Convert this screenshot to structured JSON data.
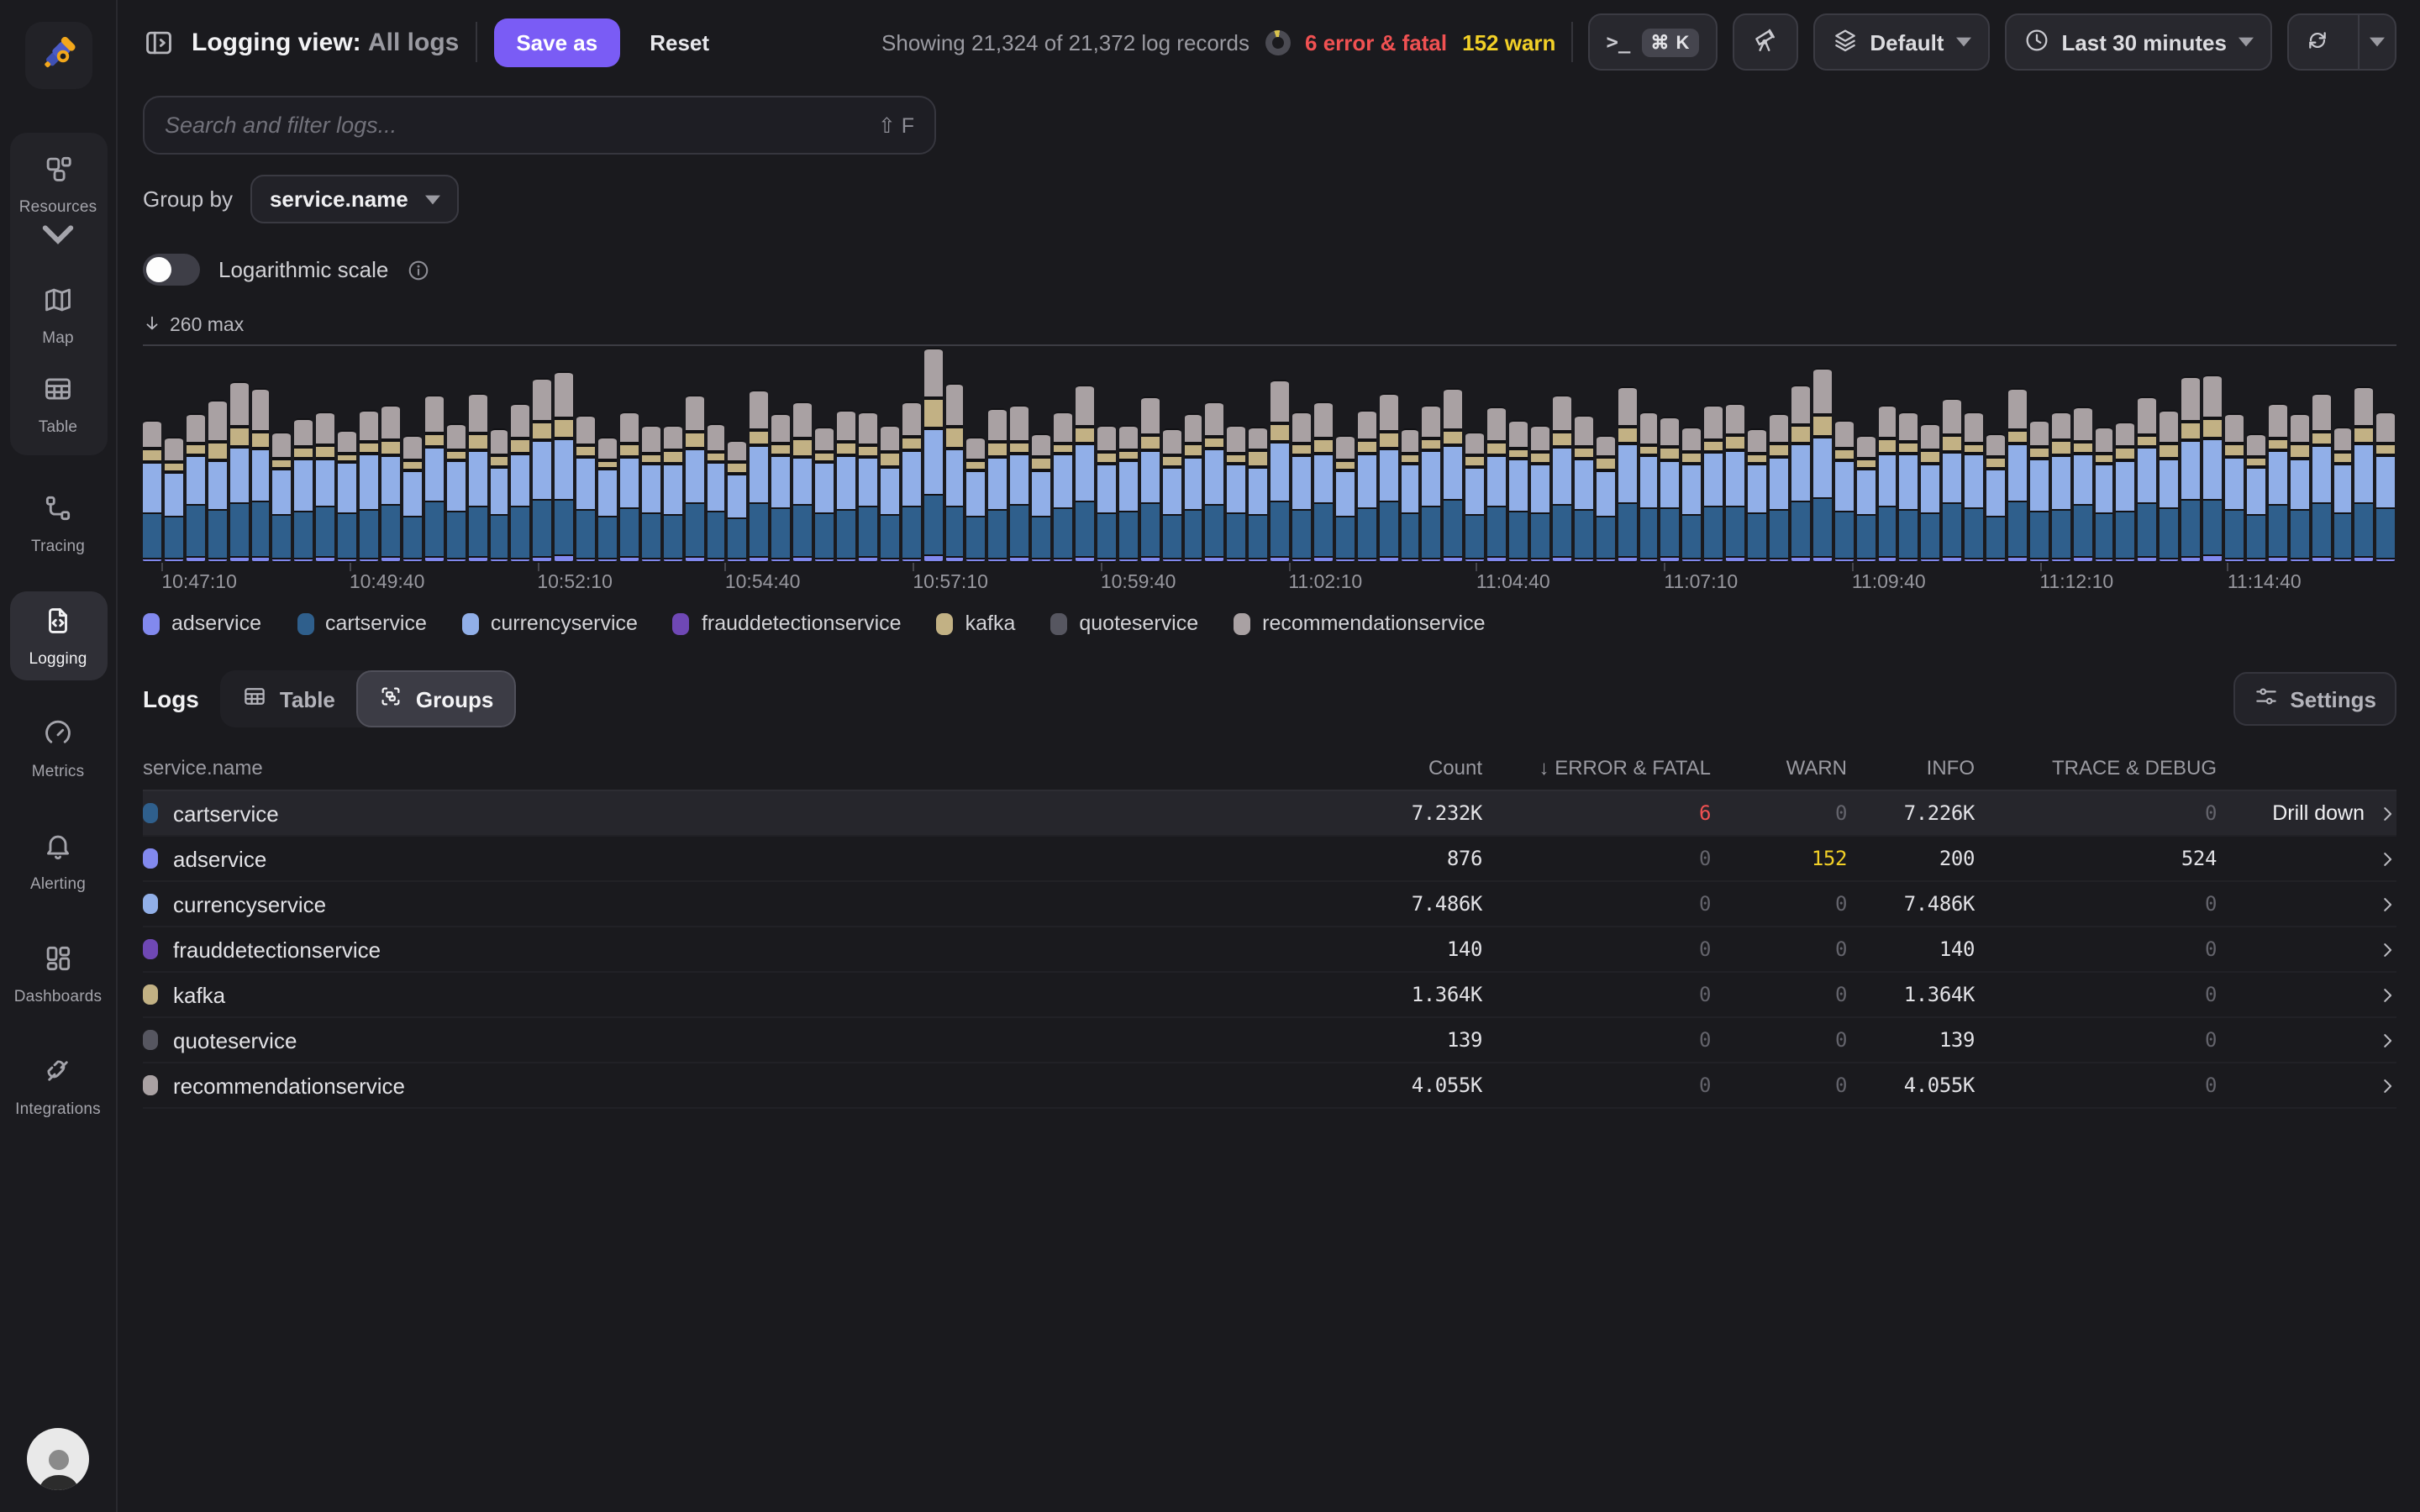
{
  "topbar": {
    "title": "Logging view:",
    "title_suffix": "All logs",
    "save_as": "Save as",
    "reset": "Reset",
    "showing": "Showing 21,324 of 21,372 log records",
    "error_badge": "6 error & fatal",
    "warn_badge": "152 warn",
    "command_shortcut": "⌘ K",
    "terminal_glyph": ">_",
    "default_label": "Default",
    "time_range": "Last 30 minutes",
    "colors": {
      "accent": "#7a5cf5",
      "error": "#f05152",
      "warn": "#f2d027"
    }
  },
  "sidebar": {
    "items": [
      {
        "label": "Resources"
      },
      {
        "label": "Map"
      },
      {
        "label": "Table"
      },
      {
        "label": "Tracing"
      },
      {
        "label": "Logging",
        "active": true
      },
      {
        "label": "Metrics"
      },
      {
        "label": "Alerting"
      },
      {
        "label": "Dashboards"
      },
      {
        "label": "Integrations"
      }
    ]
  },
  "filters": {
    "search_placeholder": "Search and filter logs...",
    "search_shortcut": "⇧ F",
    "group_by_label": "Group by",
    "group_by_value": "service.name",
    "log_scale_label": "Logarithmic scale",
    "log_scale_on": false
  },
  "chart_data": {
    "type": "bar",
    "stacked": true,
    "max_label": "260 max",
    "ylim": [
      0,
      260
    ],
    "legend_position": "bottom",
    "x_labels": [
      "10:47:10",
      "10:49:40",
      "10:52:10",
      "10:54:40",
      "10:57:10",
      "10:59:40",
      "11:02:10",
      "11:04:40",
      "11:07:10",
      "11:09:40",
      "11:12:10",
      "11:14:40"
    ],
    "series": [
      {
        "name": "adservice",
        "color": "#8289ee"
      },
      {
        "name": "cartservice",
        "color": "#2f5f8c"
      },
      {
        "name": "currencyservice",
        "color": "#91afe8"
      },
      {
        "name": "frauddetectionservice",
        "color": "#6f48b5"
      },
      {
        "name": "kafka",
        "color": "#c2b184"
      },
      {
        "name": "quoteservice",
        "color": "#565660"
      },
      {
        "name": "recommendationservice",
        "color": "#a9a1a3"
      }
    ],
    "bars": [
      [
        7,
        55,
        60,
        2,
        14,
        2,
        32
      ],
      [
        6,
        50,
        52,
        2,
        10,
        2,
        28
      ],
      [
        8,
        62,
        58,
        2,
        12,
        2,
        35
      ],
      [
        7,
        58,
        58,
        2,
        20,
        3,
        48
      ],
      [
        9,
        64,
        66,
        2,
        22,
        2,
        52
      ],
      [
        8,
        66,
        62,
        2,
        18,
        2,
        50
      ],
      [
        6,
        52,
        55,
        2,
        10,
        2,
        30
      ],
      [
        7,
        57,
        63,
        2,
        12,
        2,
        33
      ],
      [
        8,
        60,
        57,
        2,
        15,
        2,
        38
      ],
      [
        6,
        54,
        61,
        2,
        9,
        2,
        27
      ],
      [
        7,
        59,
        66,
        2,
        13,
        2,
        36
      ],
      [
        8,
        63,
        59,
        2,
        17,
        2,
        41
      ],
      [
        6,
        51,
        54,
        2,
        11,
        2,
        29
      ],
      [
        9,
        67,
        64,
        2,
        14,
        2,
        44
      ],
      [
        7,
        56,
        60,
        2,
        10,
        2,
        31
      ],
      [
        8,
        61,
        67,
        2,
        19,
        2,
        46
      ],
      [
        6,
        53,
        57,
        2,
        12,
        2,
        30
      ],
      [
        7,
        62,
        63,
        2,
        16,
        2,
        40
      ],
      [
        9,
        68,
        70,
        2,
        20,
        2,
        50
      ],
      [
        10,
        66,
        72,
        2,
        22,
        3,
        55
      ],
      [
        7,
        58,
        62,
        2,
        13,
        2,
        34
      ],
      [
        6,
        50,
        56,
        2,
        9,
        2,
        26
      ],
      [
        8,
        59,
        61,
        2,
        15,
        2,
        37
      ],
      [
        7,
        55,
        58,
        2,
        11,
        2,
        32
      ],
      [
        6,
        52,
        60,
        2,
        14,
        2,
        28
      ],
      [
        8,
        64,
        65,
        2,
        18,
        2,
        43
      ],
      [
        7,
        57,
        59,
        2,
        10,
        2,
        33
      ],
      [
        6,
        49,
        53,
        2,
        12,
        2,
        25
      ],
      [
        9,
        65,
        68,
        2,
        16,
        2,
        47
      ],
      [
        7,
        60,
        62,
        2,
        13,
        2,
        35
      ],
      [
        8,
        62,
        57,
        2,
        20,
        2,
        42
      ],
      [
        6,
        54,
        60,
        2,
        11,
        2,
        29
      ],
      [
        7,
        58,
        64,
        2,
        15,
        2,
        36
      ],
      [
        8,
        61,
        59,
        2,
        12,
        2,
        39
      ],
      [
        6,
        52,
        57,
        2,
        17,
        2,
        30
      ],
      [
        7,
        63,
        66,
        2,
        14,
        2,
        41
      ],
      [
        10,
        72,
        78,
        3,
        35,
        3,
        59
      ],
      [
        8,
        60,
        68,
        2,
        25,
        2,
        50
      ],
      [
        6,
        51,
        55,
        2,
        10,
        2,
        27
      ],
      [
        7,
        59,
        63,
        2,
        16,
        2,
        38
      ],
      [
        8,
        63,
        60,
        2,
        12,
        2,
        42
      ],
      [
        6,
        50,
        54,
        2,
        14,
        2,
        26
      ],
      [
        7,
        61,
        65,
        2,
        11,
        2,
        37
      ],
      [
        9,
        66,
        69,
        2,
        18,
        2,
        48
      ],
      [
        7,
        54,
        58,
        2,
        13,
        2,
        31
      ],
      [
        6,
        56,
        61,
        2,
        10,
        2,
        28
      ],
      [
        8,
        65,
        63,
        2,
        16,
        2,
        44
      ],
      [
        7,
        52,
        57,
        2,
        12,
        2,
        30
      ],
      [
        6,
        58,
        62,
        2,
        15,
        2,
        34
      ],
      [
        8,
        62,
        66,
        2,
        13,
        2,
        40
      ],
      [
        7,
        55,
        59,
        2,
        11,
        2,
        32
      ],
      [
        6,
        53,
        56,
        2,
        18,
        2,
        27
      ],
      [
        9,
        67,
        71,
        2,
        21,
        2,
        51
      ],
      [
        7,
        59,
        64,
        2,
        12,
        2,
        36
      ],
      [
        8,
        64,
        58,
        2,
        16,
        2,
        43
      ],
      [
        6,
        51,
        55,
        2,
        10,
        2,
        28
      ],
      [
        7,
        60,
        65,
        2,
        14,
        2,
        35
      ],
      [
        8,
        66,
        62,
        2,
        19,
        2,
        45
      ],
      [
        6,
        54,
        58,
        2,
        11,
        2,
        29
      ],
      [
        7,
        62,
        67,
        2,
        13,
        2,
        39
      ],
      [
        9,
        68,
        64,
        2,
        17,
        2,
        49
      ],
      [
        6,
        52,
        56,
        2,
        12,
        2,
        26
      ],
      [
        8,
        61,
        60,
        2,
        15,
        2,
        41
      ],
      [
        7,
        57,
        63,
        2,
        10,
        2,
        33
      ],
      [
        6,
        55,
        59,
        2,
        13,
        2,
        30
      ],
      [
        8,
        63,
        68,
        2,
        16,
        2,
        42
      ],
      [
        7,
        58,
        61,
        2,
        12,
        2,
        36
      ],
      [
        6,
        50,
        54,
        2,
        14,
        2,
        25
      ],
      [
        9,
        65,
        70,
        2,
        18,
        2,
        47
      ],
      [
        7,
        61,
        63,
        2,
        11,
        2,
        38
      ],
      [
        8,
        59,
        57,
        2,
        15,
        2,
        34
      ],
      [
        6,
        53,
        60,
        2,
        13,
        2,
        28
      ],
      [
        7,
        62,
        64,
        2,
        12,
        2,
        40
      ],
      [
        8,
        60,
        66,
        2,
        17,
        2,
        37
      ],
      [
        6,
        54,
        58,
        2,
        10,
        2,
        29
      ],
      [
        7,
        59,
        62,
        2,
        14,
        2,
        35
      ],
      [
        8,
        66,
        68,
        2,
        20,
        2,
        46
      ],
      [
        9,
        70,
        72,
        2,
        24,
        2,
        54
      ],
      [
        7,
        57,
        60,
        2,
        13,
        2,
        32
      ],
      [
        6,
        52,
        55,
        2,
        11,
        2,
        27
      ],
      [
        8,
        61,
        63,
        2,
        16,
        2,
        39
      ],
      [
        7,
        58,
        66,
        2,
        12,
        2,
        34
      ],
      [
        6,
        55,
        59,
        2,
        14,
        2,
        30
      ],
      [
        8,
        64,
        61,
        2,
        18,
        2,
        43
      ],
      [
        7,
        60,
        65,
        2,
        11,
        2,
        36
      ],
      [
        6,
        51,
        56,
        2,
        13,
        2,
        26
      ],
      [
        9,
        66,
        69,
        2,
        15,
        2,
        48
      ],
      [
        7,
        56,
        62,
        2,
        12,
        2,
        31
      ],
      [
        6,
        59,
        64,
        2,
        17,
        2,
        33
      ],
      [
        8,
        63,
        60,
        2,
        13,
        2,
        41
      ],
      [
        7,
        54,
        58,
        2,
        11,
        2,
        30
      ],
      [
        6,
        57,
        61,
        2,
        15,
        2,
        28
      ],
      [
        8,
        65,
        67,
        2,
        12,
        2,
        44
      ],
      [
        7,
        61,
        59,
        2,
        16,
        2,
        38
      ],
      [
        9,
        69,
        71,
        2,
        20,
        2,
        52
      ],
      [
        10,
        67,
        73,
        2,
        22,
        2,
        50
      ],
      [
        7,
        58,
        62,
        2,
        14,
        2,
        35
      ],
      [
        6,
        52,
        57,
        2,
        10,
        2,
        27
      ],
      [
        8,
        62,
        65,
        2,
        13,
        2,
        40
      ],
      [
        7,
        59,
        60,
        2,
        17,
        2,
        34
      ],
      [
        8,
        64,
        68,
        2,
        15,
        2,
        45
      ],
      [
        6,
        55,
        58,
        2,
        12,
        2,
        29
      ],
      [
        9,
        65,
        70,
        3,
        19,
        2,
        47
      ],
      [
        7,
        60,
        63,
        2,
        13,
        2,
        36
      ]
    ]
  },
  "logs_section": {
    "title": "Logs",
    "view_table": "Table",
    "view_groups": "Groups",
    "settings": "Settings"
  },
  "table": {
    "columns": {
      "name": "service.name",
      "count": "Count",
      "error_fatal": "ERROR & FATAL",
      "warn": "WARN",
      "info": "INFO",
      "trace_debug": "TRACE & DEBUG"
    },
    "sort_column": "ERROR & FATAL",
    "rows": [
      {
        "name": "cartservice",
        "color": "#2f5f8c",
        "count": "7.232K",
        "error_fatal": "6",
        "warn": "0",
        "info": "7.226K",
        "trace_debug": "0",
        "action": "Drill down",
        "highlighted": true
      },
      {
        "name": "adservice",
        "color": "#8289ee",
        "count": "876",
        "error_fatal": "0",
        "warn": "152",
        "info": "200",
        "trace_debug": "524"
      },
      {
        "name": "currencyservice",
        "color": "#91afe8",
        "count": "7.486K",
        "error_fatal": "0",
        "warn": "0",
        "info": "7.486K",
        "trace_debug": "0"
      },
      {
        "name": "frauddetectionservice",
        "color": "#6f48b5",
        "count": "140",
        "error_fatal": "0",
        "warn": "0",
        "info": "140",
        "trace_debug": "0"
      },
      {
        "name": "kafka",
        "color": "#c2b184",
        "count": "1.364K",
        "error_fatal": "0",
        "warn": "0",
        "info": "1.364K",
        "trace_debug": "0"
      },
      {
        "name": "quoteservice",
        "color": "#565660",
        "count": "139",
        "error_fatal": "0",
        "warn": "0",
        "info": "139",
        "trace_debug": "0"
      },
      {
        "name": "recommendationservice",
        "color": "#a9a1a3",
        "count": "4.055K",
        "error_fatal": "0",
        "warn": "0",
        "info": "4.055K",
        "trace_debug": "0"
      }
    ]
  }
}
